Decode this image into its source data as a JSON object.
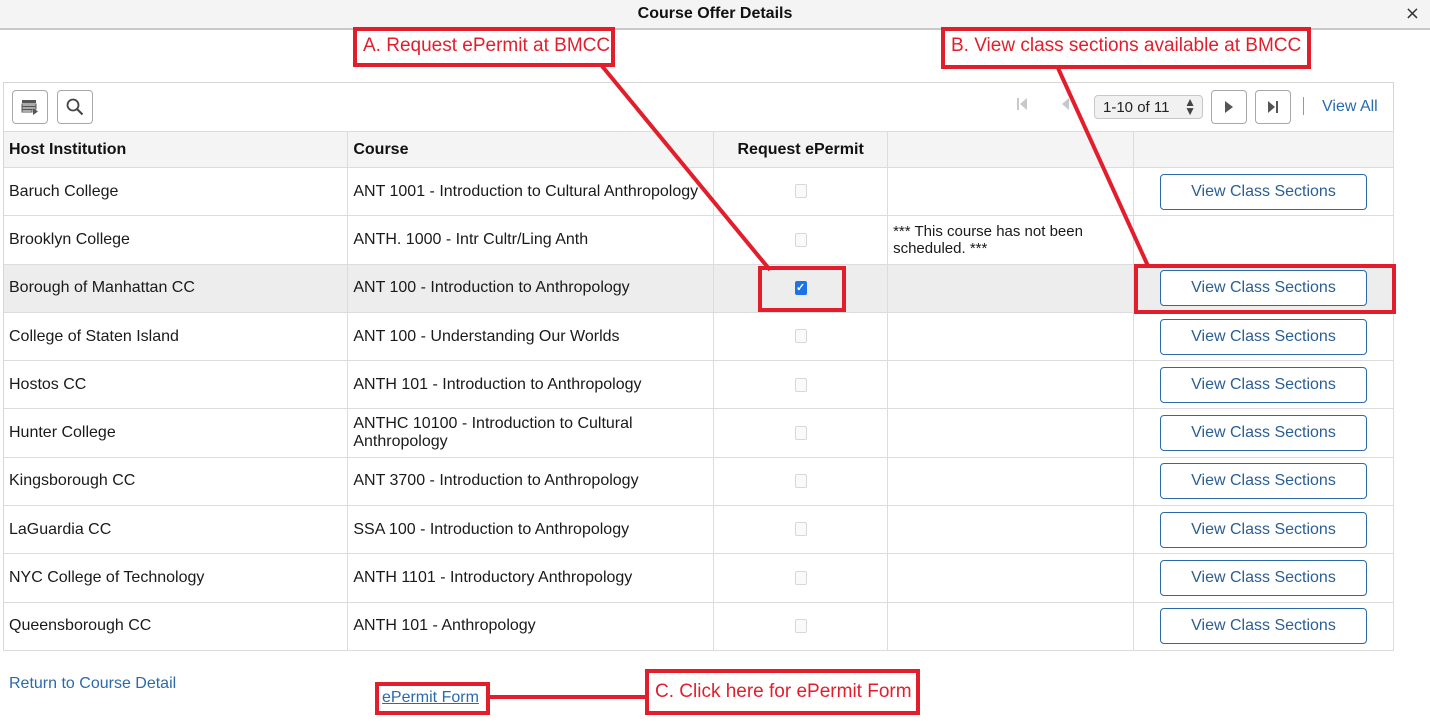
{
  "dialog": {
    "title": "Course Offer Details",
    "close_icon": "×"
  },
  "toolbar": {
    "personalize_icon": "grid-personalize-icon",
    "search_icon": "search-icon",
    "first_icon": "⏮",
    "prev_icon": "◀",
    "page_range": "1-10 of 11",
    "next_icon": "▶",
    "last_icon": "⏭",
    "view_all": "View All"
  },
  "table": {
    "headers": [
      "Host Institution",
      "Course",
      "Request ePermit",
      "",
      ""
    ],
    "rows": [
      {
        "institution": "Baruch College",
        "course": "ANT 1001 - Introduction to Cultural Anthropology",
        "epermit_checked": false,
        "note": "",
        "button": "View Class Sections"
      },
      {
        "institution": "Brooklyn College",
        "course": "ANTH. 1000 - Intr Cultr/Ling Anth",
        "epermit_checked": false,
        "note": "***  This course has not been scheduled.  ***",
        "button": ""
      },
      {
        "institution": "Borough of Manhattan CC",
        "course": "ANT  100 - Introduction to Anthropology",
        "epermit_checked": true,
        "note": "",
        "button": "View Class Sections"
      },
      {
        "institution": "College of Staten Island",
        "course": "ANT  100 - Understanding Our Worlds",
        "epermit_checked": false,
        "note": "",
        "button": "View Class Sections"
      },
      {
        "institution": "Hostos CC",
        "course": "ANTH  101 - Introduction to Anthropology",
        "epermit_checked": false,
        "note": "",
        "button": "View Class Sections"
      },
      {
        "institution": "Hunter College",
        "course": "ANTHC 10100 - Introduction to Cultural Anthropology",
        "epermit_checked": false,
        "note": "",
        "button": "View Class Sections"
      },
      {
        "institution": "Kingsborough CC",
        "course": "ANT 3700 - Introduction to Anthropology",
        "epermit_checked": false,
        "note": "",
        "button": "View Class Sections"
      },
      {
        "institution": "LaGuardia CC",
        "course": "SSA  100 - Introduction to Anthropology",
        "epermit_checked": false,
        "note": "",
        "button": "View Class Sections"
      },
      {
        "institution": "NYC College of Technology",
        "course": "ANTH 1101 - Introductory Anthropology",
        "epermit_checked": false,
        "note": "",
        "button": "View Class Sections"
      },
      {
        "institution": "Queensborough CC",
        "course": "ANTH  101 - Anthropology",
        "epermit_checked": false,
        "note": "",
        "button": "View Class Sections"
      }
    ]
  },
  "footer": {
    "return_link": "Return to Course Detail",
    "epermit_link": "ePermit Form"
  },
  "annotations": {
    "a": "A. Request ePermit at BMCC",
    "b": "B. View class sections available at BMCC",
    "c": "C. Click here for ePermit Form",
    "color": "#e21e2d"
  }
}
